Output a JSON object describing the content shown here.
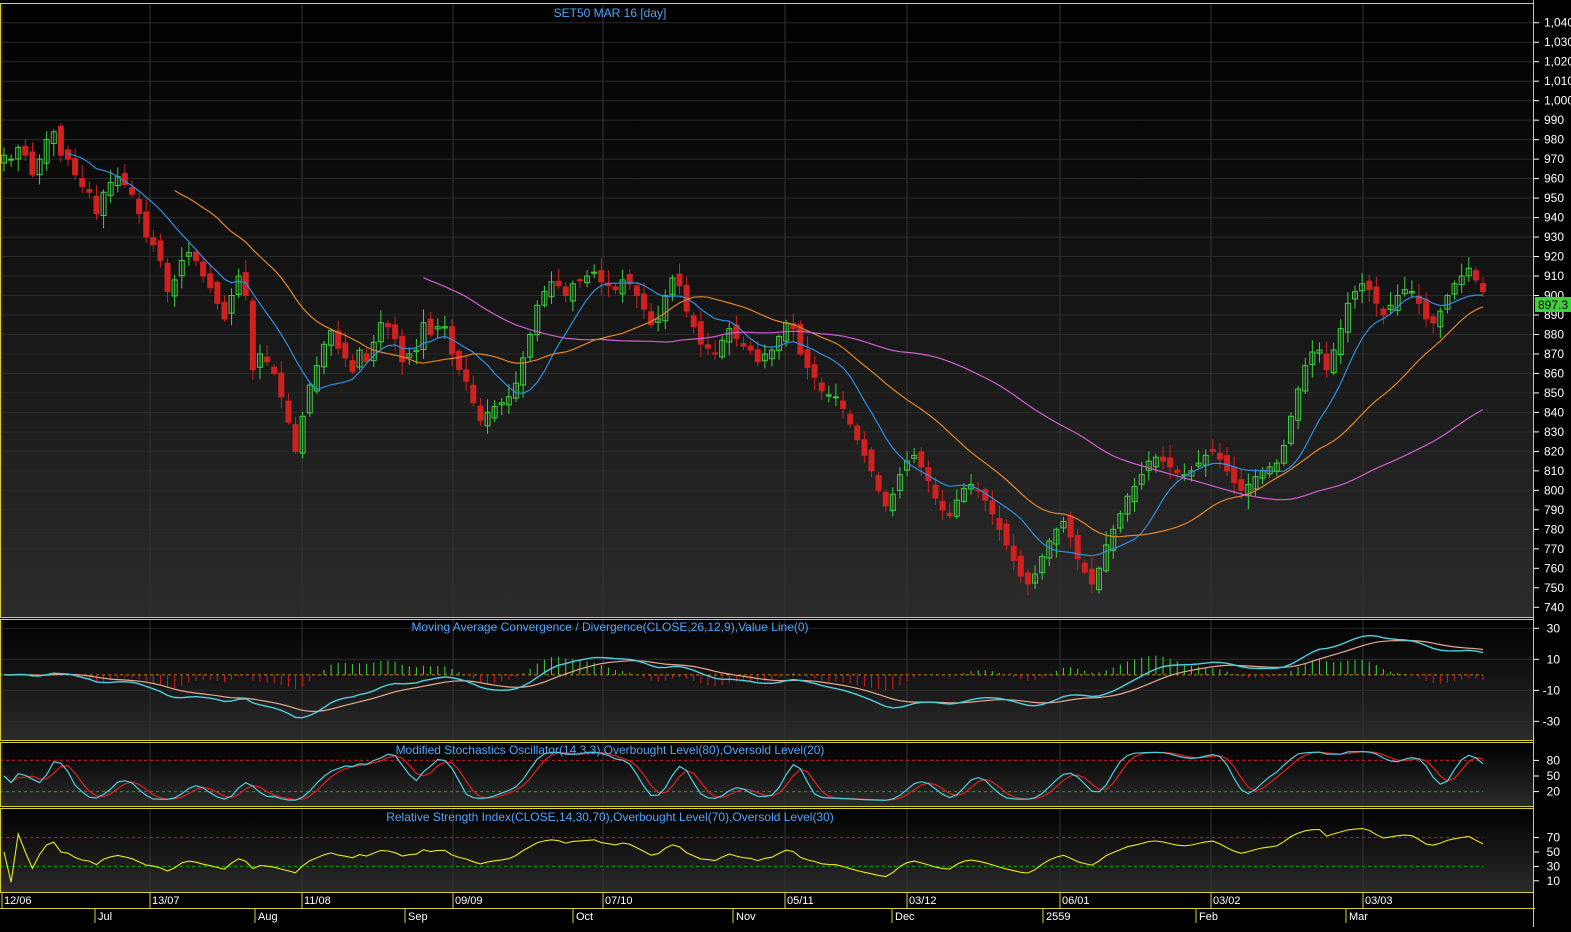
{
  "chart_data": [
    {
      "type": "candlestick",
      "title": "SET50 MAR 16   [day]",
      "ylim": [
        735,
        1045
      ],
      "y_ticks": [
        "1,040",
        "1,030",
        "1,020",
        "1,010",
        "1,000",
        "990",
        "980",
        "970",
        "960",
        "950",
        "940",
        "930",
        "920",
        "910",
        "900",
        "890",
        "880",
        "870",
        "860",
        "850",
        "840",
        "830",
        "820",
        "810",
        "800",
        "790",
        "780",
        "770",
        "760",
        "750",
        "740"
      ],
      "last_price_label": "897.3",
      "close": [
        972,
        970,
        976,
        972,
        962,
        970,
        980,
        984,
        972,
        970,
        962,
        956,
        953,
        942,
        953,
        958,
        961,
        957,
        952,
        942,
        930,
        926,
        918,
        902,
        908,
        918,
        922,
        918,
        910,
        904,
        896,
        888,
        900,
        910,
        900,
        862,
        870,
        866,
        860,
        848,
        835,
        820,
        838,
        854,
        864,
        875,
        882,
        873,
        868,
        861,
        872,
        866,
        876,
        886,
        884,
        878,
        866,
        870,
        872,
        886,
        880,
        884,
        884,
        870,
        862,
        856,
        845,
        836,
        840,
        843,
        845,
        848,
        855,
        868,
        880,
        895,
        902,
        907,
        905,
        900,
        906,
        908,
        910,
        912,
        907,
        905,
        903,
        908,
        906,
        900,
        893,
        885,
        888,
        900,
        909,
        905,
        892,
        884,
        875,
        873,
        870,
        877,
        883,
        878,
        874,
        872,
        866,
        870,
        872,
        879,
        886,
        883,
        870,
        863,
        858,
        851,
        849,
        848,
        842,
        834,
        826,
        818,
        810,
        800,
        792,
        798,
        808,
        815,
        818,
        812,
        805,
        796,
        790,
        787,
        795,
        801,
        803,
        800,
        795,
        788,
        780,
        772,
        764,
        756,
        752,
        757,
        766,
        774,
        780,
        784,
        776,
        765,
        758,
        752,
        760,
        772,
        780,
        788,
        797,
        802,
        808,
        815,
        817,
        815,
        812,
        809,
        808,
        810,
        814,
        818,
        820,
        816,
        810,
        804,
        800,
        803,
        807,
        810,
        812,
        814,
        823,
        838,
        852,
        864,
        871,
        872,
        862,
        872,
        883,
        896,
        902,
        906,
        903,
        896,
        890,
        895,
        900,
        903,
        902,
        896,
        888,
        886,
        892,
        900,
        906,
        910,
        914,
        908,
        902
      ],
      "overlay_series": [
        {
          "color": "#2f8fe0",
          "period": 10
        },
        {
          "color": "#e0852f",
          "period": 25
        },
        {
          "color": "#d060d0",
          "period": 60
        }
      ],
      "x_labels_top": [
        "12/06",
        "13/07",
        "11/08",
        "09/09",
        "07/10",
        "05/11",
        "03/12",
        "06/01",
        "03/02",
        "03/03"
      ],
      "x_labels_bottom": [
        "Jul",
        "Aug",
        "Sep",
        "Oct",
        "Nov",
        "Dec",
        "2559",
        "Feb",
        "Mar"
      ],
      "colors": {
        "up": "#3fd03f",
        "down": "#d02020",
        "background_top": "#000000",
        "background_bottom": "#2b2b2b",
        "grid": "#2a2a2a"
      }
    },
    {
      "type": "line",
      "title": "Moving Average Convergence / Divergence(CLOSE,26,12,9),Value Line(0)",
      "y_ticks": [
        "30",
        "10",
        "-10",
        "-30"
      ],
      "ylim": [
        -42,
        36
      ],
      "zero_line": 0,
      "series": [
        {
          "color": "#4fd0e0",
          "role": "macd"
        },
        {
          "color": "#e8a890",
          "role": "signal"
        },
        {
          "color": "#3fd03f",
          "role": "histogram"
        }
      ]
    },
    {
      "type": "line",
      "title": "Modified Stochastics Oscillator(14,3,3),Overbought Level(80),Oversold Level(20)",
      "y_ticks": [
        "80",
        "50",
        "20"
      ],
      "ylim": [
        0,
        100
      ],
      "levels": [
        {
          "value": 80,
          "color": "#c02020"
        },
        {
          "value": 20,
          "color": "#20a020"
        }
      ],
      "series": [
        {
          "color": "#4fd0e0",
          "role": "k"
        },
        {
          "color": "#e02020",
          "role": "d"
        }
      ]
    },
    {
      "type": "line",
      "title": "Relative Strength Index(CLOSE,14,30,70),Overbought Level(70),Oversold Level(30)",
      "y_ticks": [
        "70",
        "50",
        "30",
        "10"
      ],
      "ylim": [
        0,
        100
      ],
      "levels": [
        {
          "value": 70,
          "color": "#c02020"
        },
        {
          "value": 30,
          "color": "#20a020"
        }
      ],
      "series": [
        {
          "color": "#e8e820",
          "role": "rsi"
        }
      ]
    }
  ]
}
